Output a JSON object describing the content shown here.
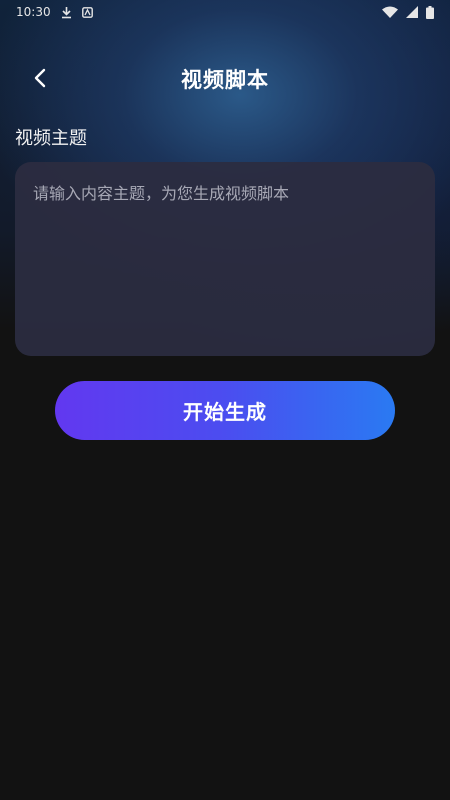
{
  "status_bar": {
    "time": "10:30",
    "icons": [
      "download-icon",
      "notification-app-icon",
      "wifi-icon",
      "cell-signal-icon",
      "battery-icon"
    ]
  },
  "header": {
    "back_icon": "chevron-left-icon",
    "title": "视频脚本"
  },
  "form": {
    "section_label": "视频主题",
    "topic_input": {
      "value": "",
      "placeholder": "请输入内容主题，为您生成视频脚本"
    },
    "submit_label": "开始生成"
  },
  "colors": {
    "background": "#121212",
    "input_background": "#2b2c40",
    "button_gradient_start": "#6238f0",
    "button_gradient_end": "#2a7af2",
    "header_glow": "#2c5c8c"
  }
}
